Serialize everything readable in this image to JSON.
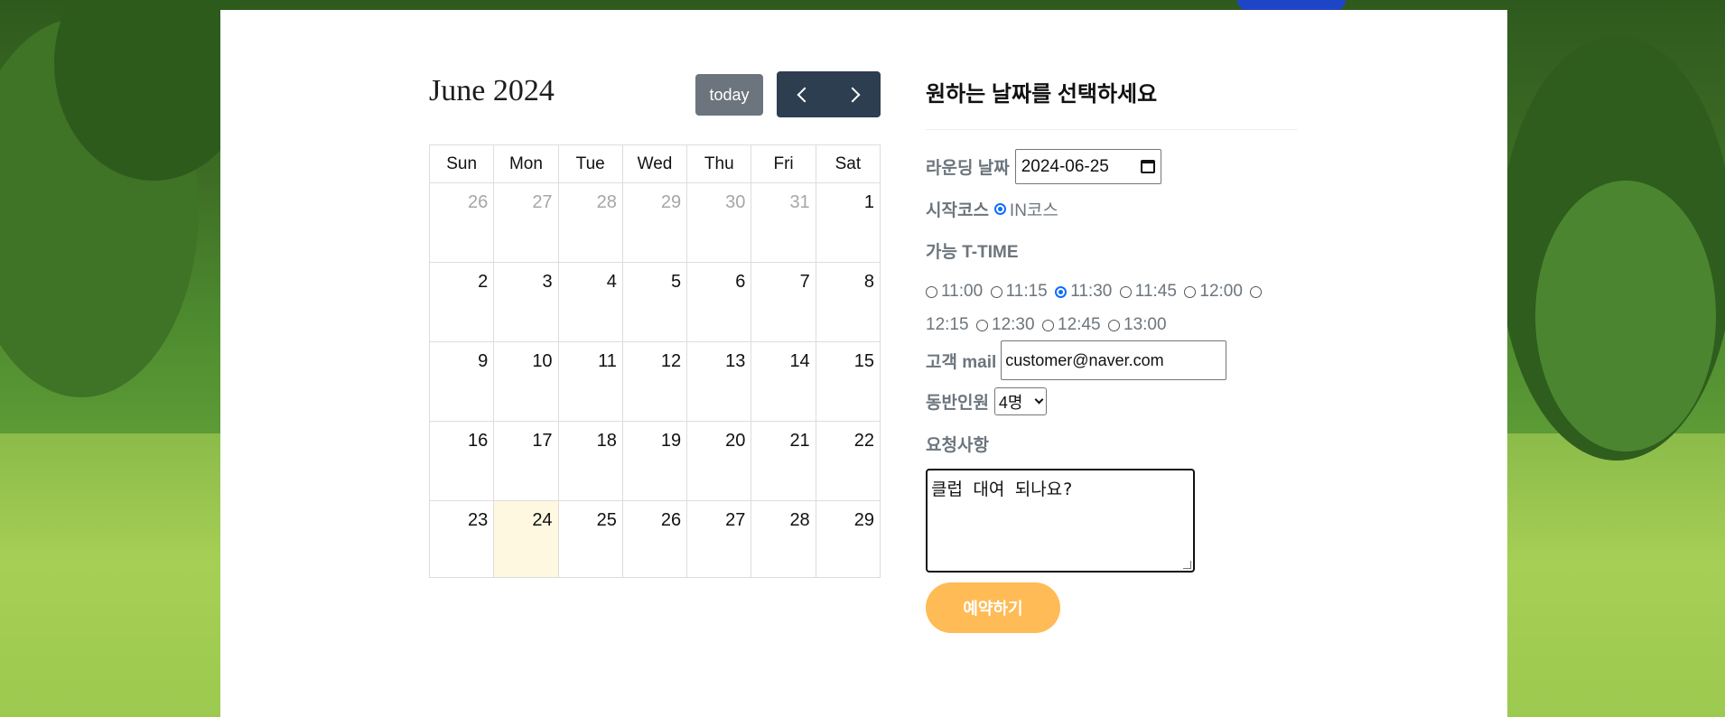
{
  "calendar": {
    "title": "June 2024",
    "today_label": "today",
    "weekdays": [
      "Sun",
      "Mon",
      "Tue",
      "Wed",
      "Thu",
      "Fri",
      "Sat"
    ],
    "weeks": [
      [
        "26",
        "27",
        "28",
        "29",
        "30",
        "31",
        "1"
      ],
      [
        "2",
        "3",
        "4",
        "5",
        "6",
        "7",
        "8"
      ],
      [
        "9",
        "10",
        "11",
        "12",
        "13",
        "14",
        "15"
      ],
      [
        "16",
        "17",
        "18",
        "19",
        "20",
        "21",
        "22"
      ],
      [
        "23",
        "24",
        "25",
        "26",
        "27",
        "28",
        "29"
      ]
    ],
    "highlighted_day": "24"
  },
  "form": {
    "title": "원하는 날짜를 선택하세요",
    "round_date_label": "라운딩 날짜",
    "round_date_value": "2024-06-25",
    "start_course_label": "시작코스",
    "start_course_option": "IN코스",
    "ttime_label": "가능 T-TIME",
    "ttimes": [
      "11:00",
      "11:15",
      "11:30",
      "11:45",
      "12:00",
      "12:15",
      "12:30",
      "12:45",
      "13:00"
    ],
    "ttime_selected": "11:30",
    "mail_label": "고객 mail",
    "mail_value": "customer@naver.com",
    "companions_label": "동반인원",
    "companions_value": "4명",
    "request_label": "요청사항",
    "request_value": "클럽 대여 되나요?",
    "submit_label": "예약하기"
  },
  "colors": {
    "today_highlight": "#fff8e0",
    "nav_button": "#2c3e50",
    "today_button": "#6c757d",
    "submit_button": "#ffbb55",
    "radio_selected": "#0d6efd"
  }
}
